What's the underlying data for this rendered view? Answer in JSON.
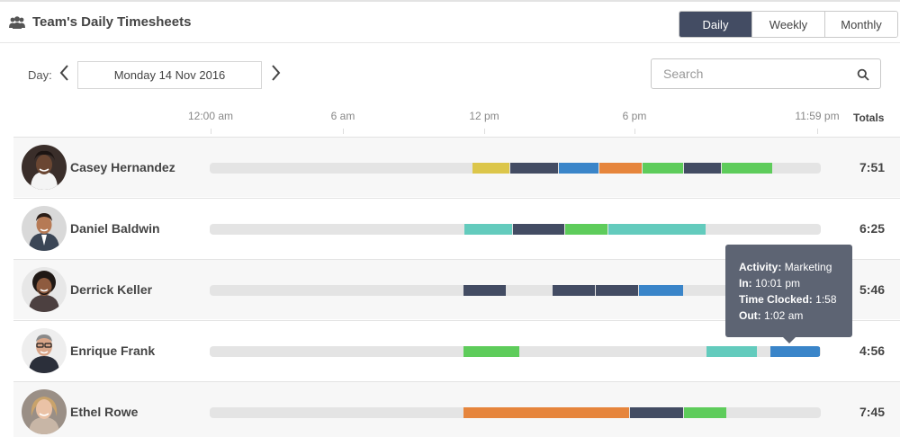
{
  "header": {
    "title": "Team's Daily Timesheets",
    "icon": "team-icon",
    "views": [
      {
        "label": "Daily",
        "active": true
      },
      {
        "label": "Weekly",
        "active": false
      },
      {
        "label": "Monthly",
        "active": false
      }
    ]
  },
  "date_nav": {
    "label": "Day:",
    "value": "Monday 14 Nov 2016"
  },
  "search": {
    "placeholder": "Search"
  },
  "timeline": {
    "ticks": [
      "12:00 am",
      "6 am",
      "12 pm",
      "6 pm",
      "11:59 pm"
    ],
    "totals_label": "Totals"
  },
  "activity_colors": {
    "yellow": "#dcc64a",
    "navy": "#434c63",
    "blue": "#3a85c9",
    "orange": "#e6853c",
    "green": "#5ecc5b",
    "teal": "#63cbbd"
  },
  "employees": [
    {
      "name": "Casey Hernandez",
      "total": "7:51",
      "segments": [
        {
          "start": "10:18",
          "end": "11:48",
          "color": "yellow"
        },
        {
          "start": "11:48",
          "end": "13:42",
          "color": "navy"
        },
        {
          "start": "13:42",
          "end": "15:18",
          "color": "blue"
        },
        {
          "start": "15:18",
          "end": "17:00",
          "color": "orange"
        },
        {
          "start": "17:00",
          "end": "18:36",
          "color": "green"
        },
        {
          "start": "18:36",
          "end": "20:06",
          "color": "navy"
        },
        {
          "start": "20:06",
          "end": "22:06",
          "color": "green"
        }
      ]
    },
    {
      "name": "Daniel Baldwin",
      "total": "6:25",
      "segments": [
        {
          "start": "10:00",
          "end": "11:54",
          "color": "teal"
        },
        {
          "start": "11:54",
          "end": "13:57",
          "color": "navy"
        },
        {
          "start": "13:57",
          "end": "15:39",
          "color": "green"
        },
        {
          "start": "15:39",
          "end": "19:30",
          "color": "teal"
        }
      ]
    },
    {
      "name": "Derrick Keller",
      "total": "5:46",
      "segments": [
        {
          "start": "09:57",
          "end": "11:39",
          "color": "navy"
        },
        {
          "start": "13:27",
          "end": "15:09",
          "color": "navy"
        },
        {
          "start": "15:09",
          "end": "16:51",
          "color": "navy"
        },
        {
          "start": "16:51",
          "end": "18:36",
          "color": "blue"
        },
        {
          "start": "20:24",
          "end": "22:06",
          "color": "navy"
        }
      ]
    },
    {
      "name": "Enrique Frank",
      "total": "4:56",
      "segments": [
        {
          "start": "09:57",
          "end": "12:12",
          "color": "green"
        },
        {
          "start": "19:30",
          "end": "21:30",
          "color": "teal"
        },
        {
          "start": "22:01",
          "end": "23:59",
          "color": "blue"
        }
      ]
    },
    {
      "name": "Ethel Rowe",
      "total": "7:45",
      "segments": [
        {
          "start": "09:57",
          "end": "16:30",
          "color": "orange"
        },
        {
          "start": "16:30",
          "end": "18:36",
          "color": "navy"
        },
        {
          "start": "18:36",
          "end": "20:18",
          "color": "green"
        }
      ]
    }
  ],
  "tooltip": {
    "activity_label": "Activity:",
    "activity_value": "Marketing",
    "in_label": "In:",
    "in_value": "10:01 pm",
    "clocked_label": "Time Clocked:",
    "clocked_value": "1:58",
    "out_label": "Out:",
    "out_value": "1:02 am"
  }
}
